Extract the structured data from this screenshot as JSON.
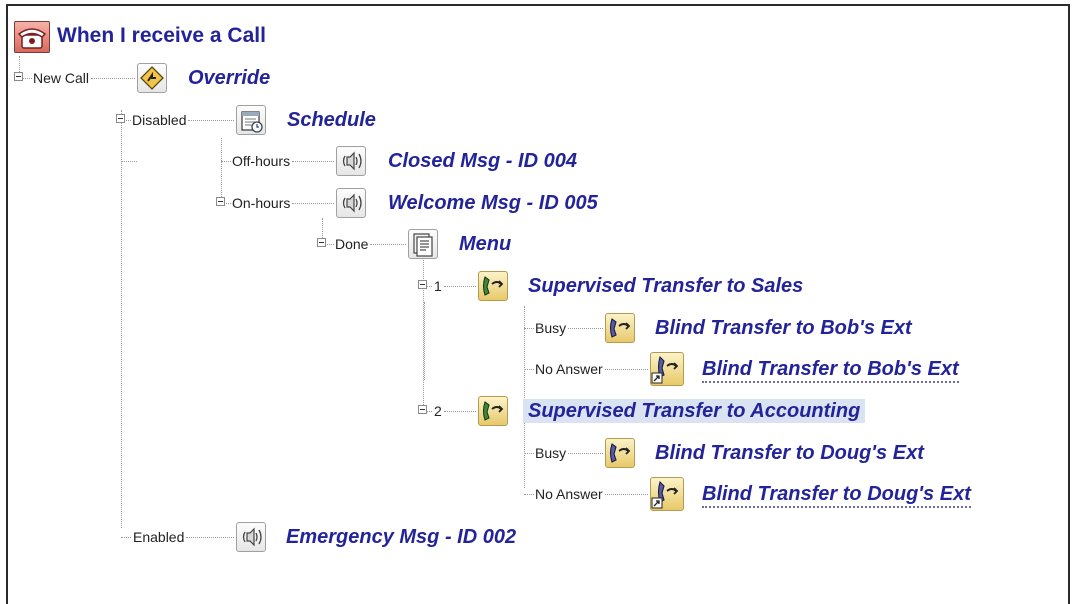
{
  "root": {
    "label": "When I receive a Call"
  },
  "nodes": [
    {
      "id": "override",
      "branch": "New Call",
      "label": "Override",
      "icon": "override-icon"
    },
    {
      "id": "schedule",
      "branch": "Disabled",
      "label": "Schedule",
      "icon": "schedule-icon"
    },
    {
      "id": "closed",
      "branch": "Off-hours",
      "label": "Closed Msg - ID 004",
      "icon": "speaker-icon"
    },
    {
      "id": "welcome",
      "branch": "On-hours",
      "label": "Welcome Msg - ID 005",
      "icon": "speaker-icon"
    },
    {
      "id": "menu",
      "branch": "Done",
      "label": "Menu",
      "icon": "menu-icon"
    },
    {
      "id": "sup-sales",
      "branch": "1",
      "label": "Supervised Transfer to Sales",
      "icon": "supervised-transfer-icon"
    },
    {
      "id": "bob-busy",
      "branch": "Busy",
      "label": "Blind Transfer to Bob's Ext",
      "icon": "blind-transfer-icon"
    },
    {
      "id": "bob-noans",
      "branch": "No Answer",
      "label": "Blind Transfer to Bob's Ext",
      "icon": "blind-transfer-shortcut-icon"
    },
    {
      "id": "sup-acct",
      "branch": "2",
      "label": "Supervised Transfer to Accounting",
      "icon": "supervised-transfer-icon",
      "selected": true
    },
    {
      "id": "doug-busy",
      "branch": "Busy",
      "label": "Blind Transfer to Doug's Ext",
      "icon": "blind-transfer-icon"
    },
    {
      "id": "doug-noans",
      "branch": "No Answer",
      "label": "Blind Transfer to Doug's Ext",
      "icon": "blind-transfer-shortcut-icon"
    },
    {
      "id": "emergency",
      "branch": "Enabled",
      "label": "Emergency Msg - ID 002",
      "icon": "speaker-icon"
    }
  ]
}
